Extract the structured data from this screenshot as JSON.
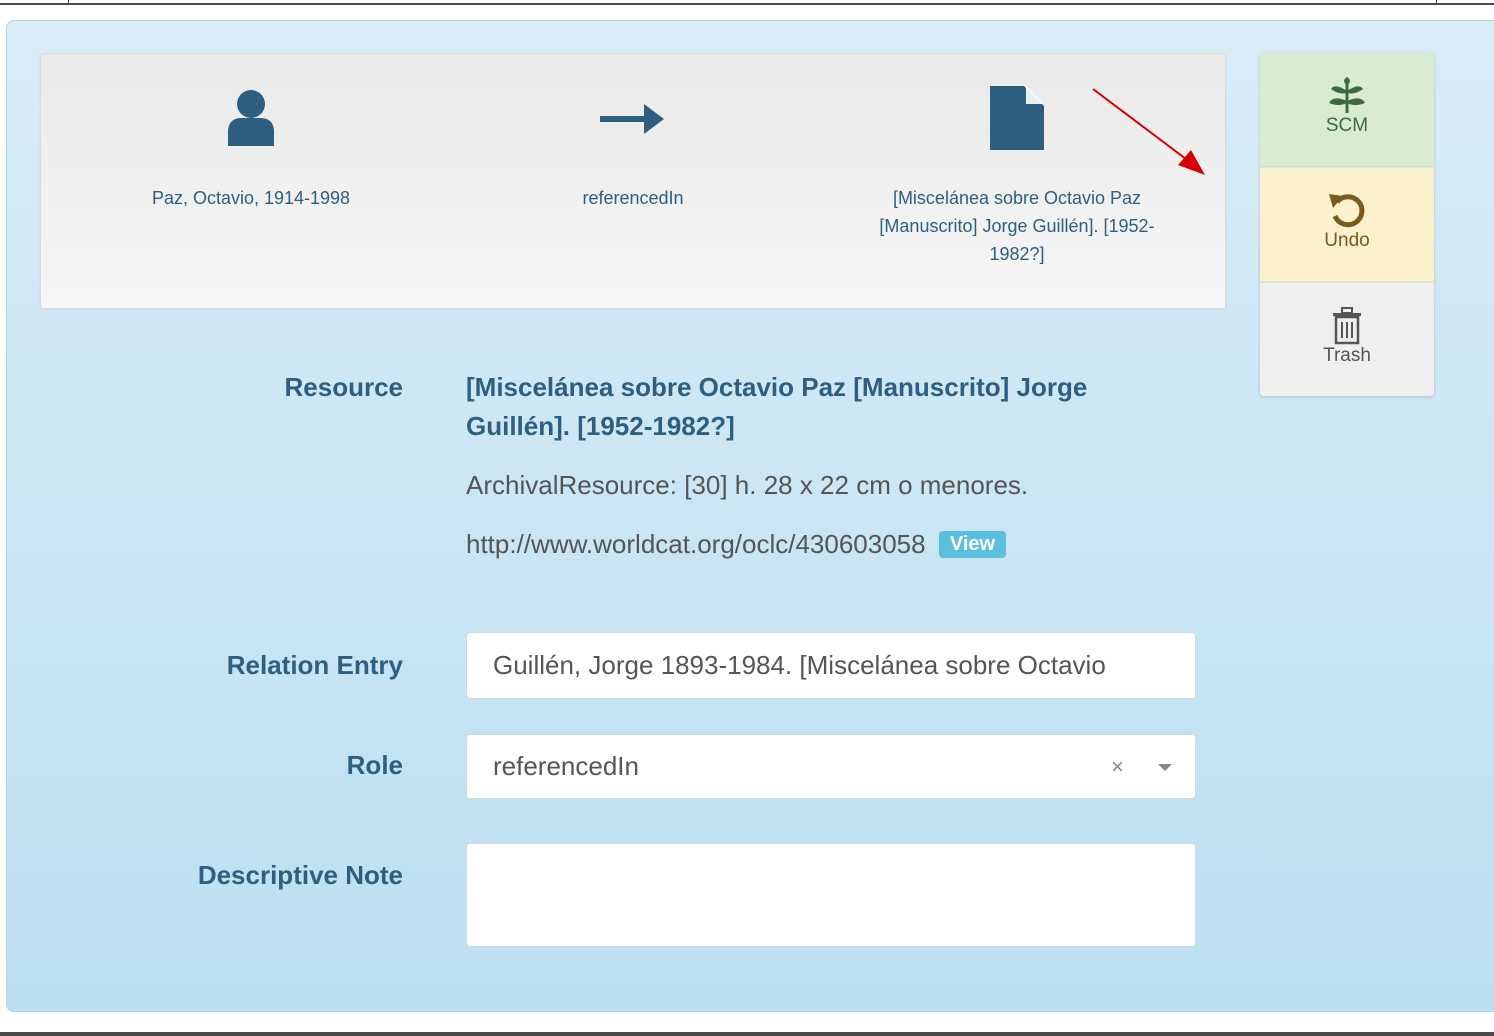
{
  "summary": {
    "subject": "Paz, Octavio, 1914-1998",
    "relation": "referencedIn",
    "object_lines": [
      "[Miscelánea sobre Octavio Paz",
      "[Manuscrito] Jorge Guillén]. [1952-",
      "1982?]"
    ],
    "subject_icon": "user-icon",
    "relation_icon": "arrow-right-icon",
    "object_icon": "document-icon"
  },
  "annotation": {
    "arrow_color": "#d40000"
  },
  "sidebar": {
    "scm_label": "SCM",
    "scm_icon": "leaf-icon",
    "undo_label": "Undo",
    "undo_icon": "undo-icon",
    "trash_label": "Trash",
    "trash_icon": "trash-icon"
  },
  "resource": {
    "label": "Resource",
    "title_lines": [
      "[Miscelánea sobre Octavio Paz [Manuscrito] Jorge",
      "Guillén]. [1952-1982?]"
    ],
    "type_line": "ArchivalResource: [30] h. 28 x 22 cm o menores.",
    "link": "http://www.worldcat.org/oclc/430603058",
    "view_label": "View"
  },
  "relation_entry": {
    "label": "Relation Entry",
    "value": "Guillén, Jorge 1893-1984. [Miscelánea sobre Octavio"
  },
  "role": {
    "label": "Role",
    "value": "referencedIn",
    "clear_symbol": "×"
  },
  "descriptive_note": {
    "label": "Descriptive Note",
    "value": ""
  },
  "colors": {
    "accent": "#2e5f80",
    "panel_top": "#d9ecf8",
    "panel_bottom": "#bcdff0",
    "scm_bg": "#d7ecd0",
    "undo_bg": "#fbf1cc",
    "trash_bg": "#efefef",
    "view_badge": "#5bc0de"
  }
}
